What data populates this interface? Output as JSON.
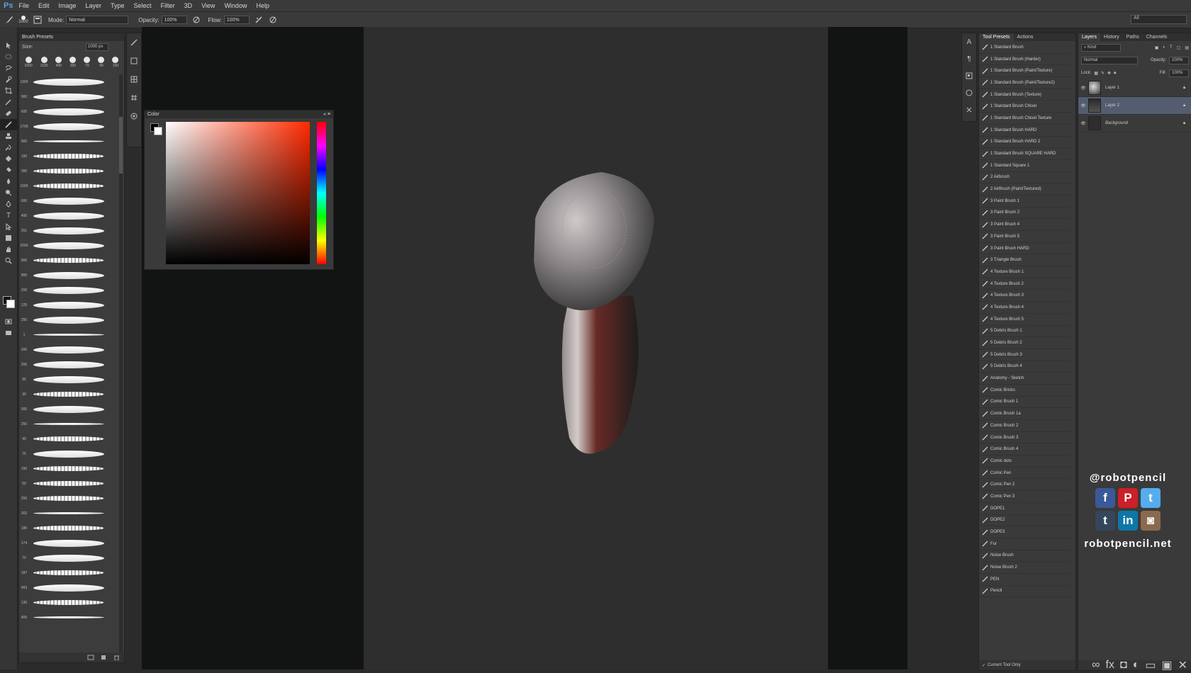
{
  "app": {
    "logo": "Ps"
  },
  "menu": [
    "File",
    "Edit",
    "Image",
    "Layer",
    "Type",
    "Select",
    "Filter",
    "3D",
    "View",
    "Window",
    "Help"
  ],
  "options": {
    "brush_size": "1000",
    "mode_label": "Mode:",
    "mode_value": "Normal",
    "opacity_label": "Opacity:",
    "opacity_value": "100%",
    "flow_label": "Flow:",
    "flow_value": "100%",
    "workspace": "All"
  },
  "brush_panel": {
    "title": "Brush Presets",
    "size_label": "Size:",
    "size_value": "1000 px",
    "presets": [
      "1000",
      "1100",
      "400",
      "250",
      "70",
      "90",
      "100"
    ],
    "strokes": [
      {
        "num": "1300",
        "style": "normal"
      },
      {
        "num": "900",
        "style": "normal"
      },
      {
        "num": "600",
        "style": "normal"
      },
      {
        "num": "1700",
        "style": "normal"
      },
      {
        "num": "900",
        "style": "thin"
      },
      {
        "num": "150",
        "style": "rough"
      },
      {
        "num": "300",
        "style": "rough"
      },
      {
        "num": "1000",
        "style": "rough"
      },
      {
        "num": "600",
        "style": "normal"
      },
      {
        "num": "400",
        "style": "normal"
      },
      {
        "num": "201",
        "style": "normal"
      },
      {
        "num": "2000",
        "style": "normal"
      },
      {
        "num": "900",
        "style": "rough"
      },
      {
        "num": "800",
        "style": "normal"
      },
      {
        "num": "200",
        "style": "normal"
      },
      {
        "num": "125",
        "style": "normal"
      },
      {
        "num": "250",
        "style": "normal"
      },
      {
        "num": "1",
        "style": "thin"
      },
      {
        "num": "200",
        "style": "normal"
      },
      {
        "num": "200",
        "style": "normal"
      },
      {
        "num": "90",
        "style": "normal"
      },
      {
        "num": "30",
        "style": "rough"
      },
      {
        "num": "500",
        "style": "normal"
      },
      {
        "num": "250",
        "style": "thin"
      },
      {
        "num": "40",
        "style": "rough"
      },
      {
        "num": "75",
        "style": "normal"
      },
      {
        "num": "150",
        "style": "rough"
      },
      {
        "num": "60",
        "style": "rough"
      },
      {
        "num": "250",
        "style": "rough"
      },
      {
        "num": "202",
        "style": "thin"
      },
      {
        "num": "180",
        "style": "rough"
      },
      {
        "num": "174",
        "style": "normal"
      },
      {
        "num": "70",
        "style": "normal"
      },
      {
        "num": "187",
        "style": "rough"
      },
      {
        "num": "463",
        "style": "normal"
      },
      {
        "num": "130",
        "style": "rough"
      },
      {
        "num": "405",
        "style": "thin"
      }
    ]
  },
  "color_panel": {
    "title": "Color"
  },
  "tool_presets": {
    "tabs": [
      "Tool Presets",
      "Actions"
    ],
    "items": [
      "1 Standard Brush",
      "1 Standard Brush (Harder)",
      "1 Standard Brush (Paint/Texture)",
      "1 Standard Brush (Paint/Texture2)",
      "1 Standard Brush (Texture)",
      "1 Standard Brush Chisel",
      "1 Standard Brush Chisel Texture",
      "1 Standard Brush HARD",
      "1 Standard Brush HARD 2",
      "1 Standard Brush SQUARE HARD",
      "1 Standard Square 1",
      "2 Airbrush",
      "2 AirBrush (Paint/Textured)",
      "3 Paint Brush 1",
      "3 Paint Brush 2",
      "3 Paint Brush 4",
      "3 Paint Brush 5",
      "3 Paint Brush HARD",
      "3 Triangle Brush",
      "4 Texture Brush 1",
      "4 Texture Brush 2",
      "4 Texture Brush 3",
      "4 Texture Brush 4",
      "4 Texture Brush 5",
      "5 Debris Brush 1",
      "5 Debris Brush 2",
      "5 Debris Brush 3",
      "5 Debris Brush 4",
      "Anatomy - Sketch",
      "Comic Bricks",
      "Comic Brush 1",
      "Comic Brush 1a",
      "Comic Brush 2",
      "Comic Brush 3",
      "Comic Brush 4",
      "Comic dots",
      "Comic Pen",
      "Comic Pen 2",
      "Comic Pen 3",
      "DOPE1",
      "DOPE2",
      "DOPE3",
      "Fur",
      "Noise Brush",
      "Noise Brush 2",
      "PEN",
      "Pencil"
    ],
    "footer": "Current Tool Only"
  },
  "layers_panel": {
    "tabs": [
      "Layers",
      "History",
      "Paths",
      "Channels"
    ],
    "kind_label": "Kind",
    "blend_mode": "Normal",
    "opacity_label": "Opacity:",
    "opacity_value": "100%",
    "lock_label": "Lock:",
    "fill_label": "Fill:",
    "fill_value": "100%",
    "layers": [
      {
        "name": "Layer 1",
        "selected": false,
        "thumb": "l1"
      },
      {
        "name": "Layer 2",
        "selected": true,
        "thumb": "l2"
      },
      {
        "name": "Background",
        "selected": false,
        "thumb": "bg"
      }
    ]
  },
  "watermark": {
    "handle": "@robotpencil",
    "site": "robotpencil.net",
    "icons": [
      {
        "name": "facebook-icon",
        "glyph": "f",
        "color": "#3b5998"
      },
      {
        "name": "pinterest-icon",
        "glyph": "P",
        "color": "#cb2027"
      },
      {
        "name": "twitter-icon",
        "glyph": "t",
        "color": "#55acee"
      },
      {
        "name": "tumblr-icon",
        "glyph": "t",
        "color": "#35465c"
      },
      {
        "name": "linkedin-icon",
        "glyph": "in",
        "color": "#0e76a8"
      },
      {
        "name": "instagram-icon",
        "glyph": "◙",
        "color": "#8a6a4f"
      }
    ]
  }
}
